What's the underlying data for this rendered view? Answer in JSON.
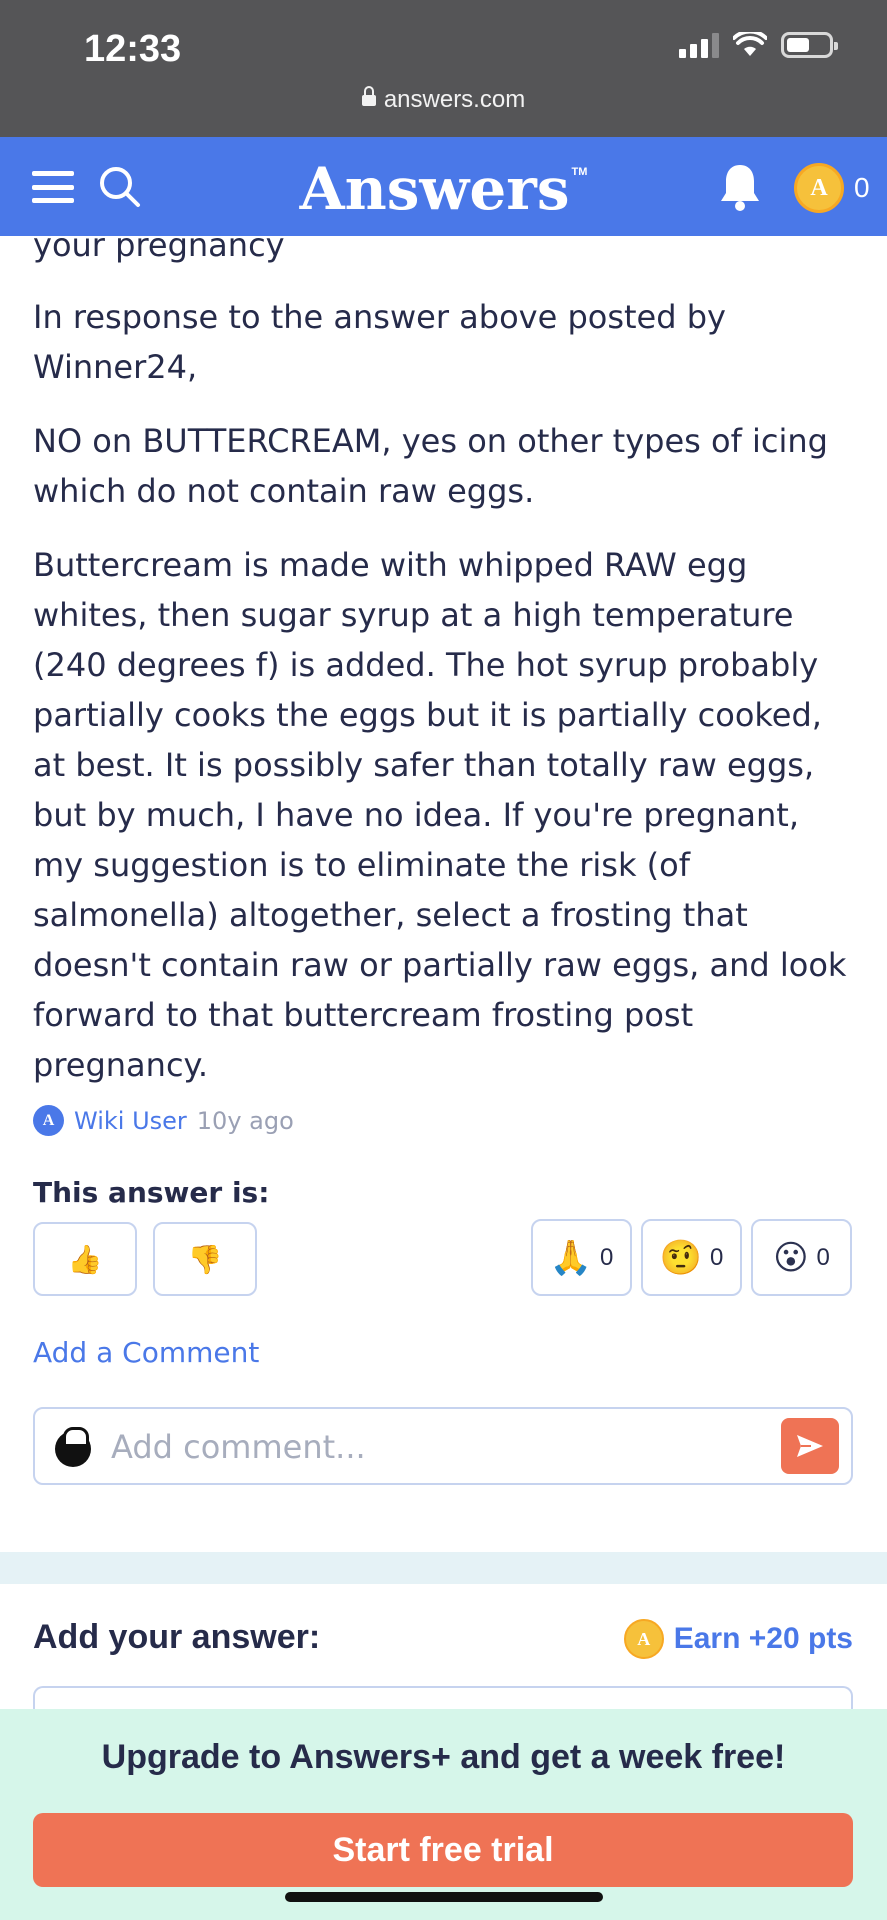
{
  "status_bar": {
    "time": "12:33",
    "url": "answers.com"
  },
  "nav": {
    "brand": "Answers",
    "trademark": "TM",
    "coin_count": "0",
    "coin_letter": "A"
  },
  "answer": {
    "paragraphs": [
      "your pregnancy",
      "In response to the answer above posted by Winner24,",
      "NO on BUTTERCREAM, yes on other types of icing which do not contain raw eggs.",
      "Buttercream is made with whipped RAW egg whites, then sugar syrup at a high temperature (240 degrees f) is added. The hot syrup probably partially cooks the eggs but it is partially cooked, at best. It is possibly safer than totally raw eggs, but by much, I have no idea. If you're pregnant, my suggestion is to eliminate the risk (of salmonella) altogether, select a frosting that doesn't contain raw or partially raw eggs, and look forward to that buttercream frosting post pregnancy."
    ],
    "author": "Wiki User",
    "posted": "10y ago"
  },
  "rating": {
    "title": "This answer is:",
    "thumbs_up": "👍",
    "thumbs_down": "👎",
    "reactions": [
      {
        "emoji": "🙏",
        "count": "0"
      },
      {
        "emoji": "🤨",
        "count": "0"
      },
      {
        "emoji": "😮",
        "count": "0"
      }
    ]
  },
  "comments": {
    "add_link": "Add a Comment",
    "placeholder": "Add comment..."
  },
  "add_answer": {
    "title": "Add your answer:",
    "earn": "Earn +20 pts"
  },
  "promo": {
    "text": "Upgrade to Answers+ and get a week free!",
    "button": "Start free trial"
  },
  "colors": {
    "brand_blue": "#4a78e8",
    "accent_orange": "#ef7355",
    "promo_bg": "#d6f6ea",
    "coin": "#f6c13b"
  }
}
